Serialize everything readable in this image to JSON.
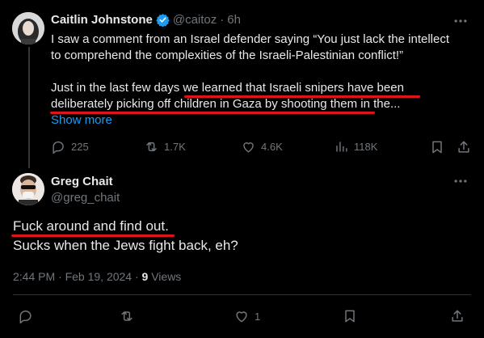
{
  "tweet1": {
    "name": "Caitlin Johnstone",
    "handle": "@caitoz",
    "separator": "·",
    "age": "6h",
    "text_line1": "I saw a comment from an Israel defender saying “You just lack the intellect",
    "text_line2": "to comprehend the complexities of the Israeli-Palestinian conflict!”",
    "text_line3": "Just in the last few days we learned that Israeli snipers have been",
    "text_line4": "deliberately picking off children in Gaza by shooting them in the...",
    "show_more": "Show more",
    "actions": {
      "replies": "225",
      "reposts": "1.7K",
      "likes": "4.6K",
      "views": "118K"
    },
    "more_icon": "more-dots-icon"
  },
  "tweet2": {
    "name": "Greg Chait",
    "handle": "@greg_chait",
    "text_line1": "Fuck around and find out.",
    "text_line2": "Sucks when the Jews fight back, eh?",
    "timestamp": "2:44 PM · Feb 19, 2024 · ",
    "views_count": "9",
    "views_label": " Views",
    "actions": {
      "likes": "1"
    }
  },
  "colors": {
    "background": "#000000",
    "text": "#e7e9ea",
    "muted": "#71767b",
    "link": "#1d9bf0",
    "verified": "#1d9bf0",
    "annotation": "#e0121a"
  }
}
